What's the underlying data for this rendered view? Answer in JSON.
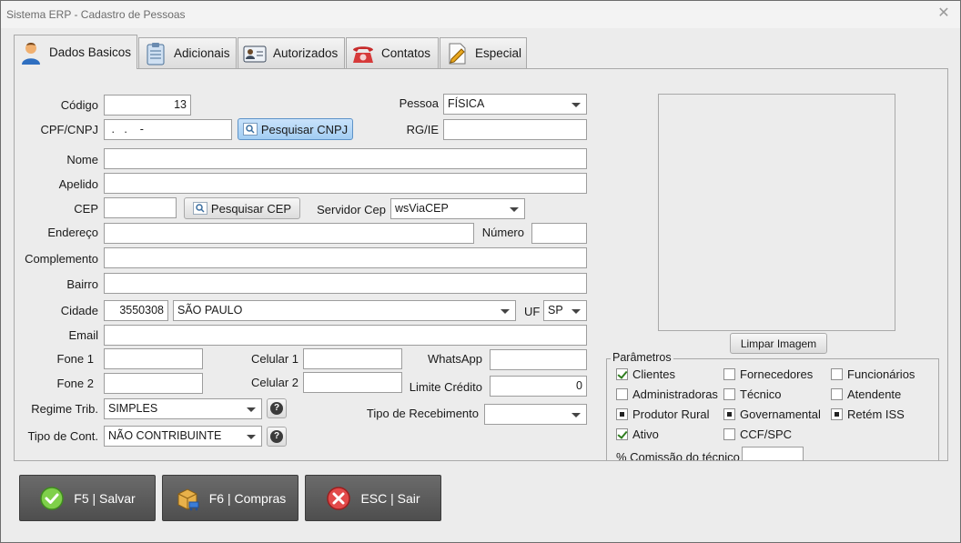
{
  "window": {
    "title": "Sistema ERP - Cadastro de Pessoas",
    "close_glyph": "✕"
  },
  "tabs": [
    {
      "label": "Dados Basicos",
      "icon": "person-icon",
      "active": true
    },
    {
      "label": "Adicionais",
      "icon": "clipboard-icon"
    },
    {
      "label": "Autorizados",
      "icon": "id-card-icon"
    },
    {
      "label": "Contatos",
      "icon": "telephone-icon"
    },
    {
      "label": "Especial",
      "icon": "pen-document-icon"
    }
  ],
  "form": {
    "codigo": {
      "label": "Código",
      "value": "13"
    },
    "pessoa": {
      "label": "Pessoa",
      "value": "FÍSICA"
    },
    "cpf": {
      "label": "CPF/CNPJ",
      "value": " .   .    -"
    },
    "pesquisar_cnpj": "Pesquisar CNPJ",
    "rg": {
      "label": "RG/IE",
      "value": ""
    },
    "nome": {
      "label": "Nome",
      "value": ""
    },
    "apelido": {
      "label": "Apelido",
      "value": ""
    },
    "cep": {
      "label": "CEP",
      "value": ""
    },
    "pesquisar_cep": "Pesquisar CEP",
    "servidor_cep": {
      "label": "Servidor Cep",
      "value": "wsViaCEP"
    },
    "endereco": {
      "label": "Endereço",
      "value": ""
    },
    "numero": {
      "label": "Número",
      "value": ""
    },
    "complemento": {
      "label": "Complemento",
      "value": ""
    },
    "bairro": {
      "label": "Bairro",
      "value": ""
    },
    "cidade": {
      "label": "Cidade",
      "code": "3550308",
      "name": "SÃO PAULO"
    },
    "uf": {
      "label": "UF",
      "value": "SP"
    },
    "email": {
      "label": "Email",
      "value": ""
    },
    "fone1": {
      "label": "Fone 1",
      "value": ""
    },
    "celular1": {
      "label": "Celular 1",
      "value": ""
    },
    "whatsapp": {
      "label": "WhatsApp",
      "value": ""
    },
    "fone2": {
      "label": "Fone 2",
      "value": ""
    },
    "celular2": {
      "label": "Celular 2",
      "value": ""
    },
    "limite_credito": {
      "label": "Limite Crédito",
      "value": "0"
    },
    "regime_trib": {
      "label": "Regime Trib.",
      "value": "SIMPLES"
    },
    "tipo_recebimento": {
      "label": "Tipo de Recebimento",
      "value": ""
    },
    "tipo_cont": {
      "label": "Tipo de Cont.",
      "value": "NÃO CONTRIBUINTE"
    },
    "help_glyph": "?"
  },
  "image": {
    "clear_button": "Limpar Imagem"
  },
  "params": {
    "title": "Parâmetros",
    "items": [
      {
        "label": "Clientes",
        "state": "checked"
      },
      {
        "label": "Fornecedores",
        "state": "unchecked"
      },
      {
        "label": "Funcionários",
        "state": "unchecked"
      },
      {
        "label": "Administradoras",
        "state": "unchecked"
      },
      {
        "label": "Técnico",
        "state": "unchecked"
      },
      {
        "label": "Atendente",
        "state": "unchecked"
      },
      {
        "label": "Produtor Rural",
        "state": "indeterminate"
      },
      {
        "label": "Governamental",
        "state": "indeterminate"
      },
      {
        "label": "Retém ISS",
        "state": "indeterminate"
      },
      {
        "label": "Ativo",
        "state": "checked"
      },
      {
        "label": "CCF/SPC",
        "state": "unchecked"
      }
    ],
    "comissao_label": "% Comissão do técnico"
  },
  "actions": {
    "salvar": "F5 | Salvar",
    "compras": "F6 | Compras",
    "sair": "ESC | Sair"
  }
}
